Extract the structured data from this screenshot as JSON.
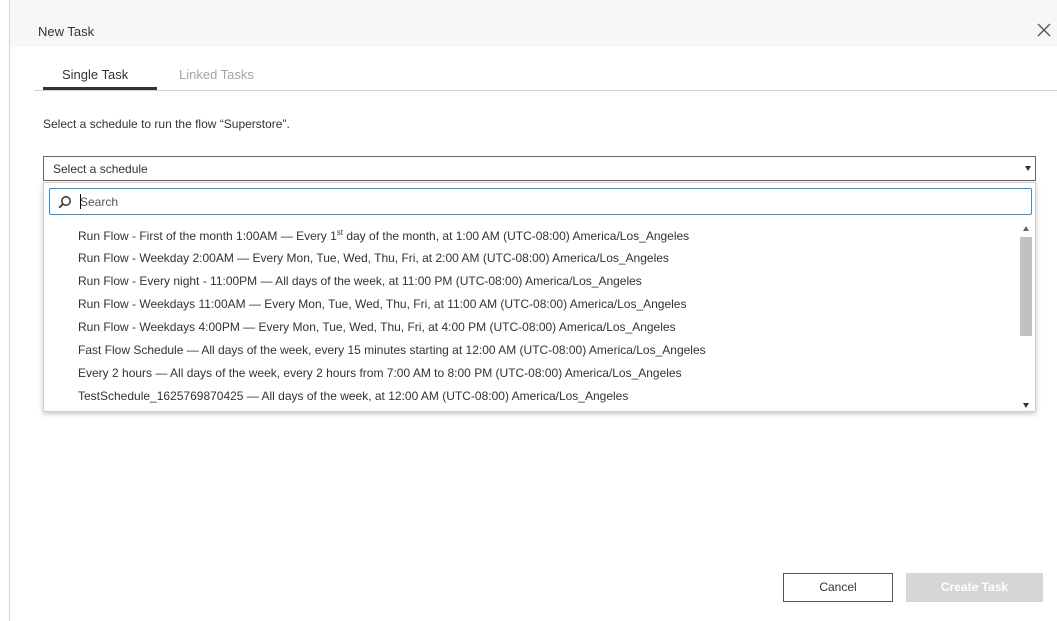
{
  "dialog": {
    "title": "New Task",
    "close_icon": "close-icon"
  },
  "tabs": [
    {
      "label": "Single Task",
      "active": true
    },
    {
      "label": "Linked Tasks",
      "active": false
    }
  ],
  "instruction": "Select a schedule to run the flow “Superstore”.",
  "schedule_select": {
    "selected": "Select a schedule",
    "arrow_icon": "dropdown-arrow-icon"
  },
  "search": {
    "placeholder": "Search",
    "value": "",
    "icon": "search-icon"
  },
  "options": [
    {
      "label": "Run Flow - First of the month 1:00AM — Every 1",
      "sup": "st",
      "label_tail": " day of the month, at 1:00 AM (UTC-08:00) America/Los_Angeles"
    },
    {
      "label": "Run Flow - Weekday 2:00AM — Every Mon, Tue, Wed, Thu, Fri, at 2:00 AM (UTC-08:00) America/Los_Angeles"
    },
    {
      "label": "Run Flow - Every night - 11:00PM — All days of the week, at 11:00 PM (UTC-08:00) America/Los_Angeles"
    },
    {
      "label": "Run Flow - Weekdays 11:00AM — Every Mon, Tue, Wed, Thu, Fri, at 11:00 AM (UTC-08:00) America/Los_Angeles"
    },
    {
      "label": "Run Flow - Weekdays 4:00PM — Every Mon, Tue, Wed, Thu, Fri, at 4:00 PM (UTC-08:00) America/Los_Angeles"
    },
    {
      "label": "Fast Flow Schedule — All days of the week, every 15 minutes starting at 12:00 AM (UTC-08:00) America/Los_Angeles"
    },
    {
      "label": "Every 2 hours — All days of the week, every 2 hours from 7:00 AM to 8:00 PM (UTC-08:00) America/Los_Angeles"
    },
    {
      "label": "TestSchedule_1625769870425 — All days of the week, at 12:00 AM (UTC-08:00) America/Los_Angeles"
    }
  ],
  "buttons": {
    "cancel": "Cancel",
    "create": "Create Task"
  },
  "colors": {
    "focus_border": "#2f8fd6",
    "disabled_button": "#d6d6d6",
    "tab_active_underline": "#333333"
  }
}
